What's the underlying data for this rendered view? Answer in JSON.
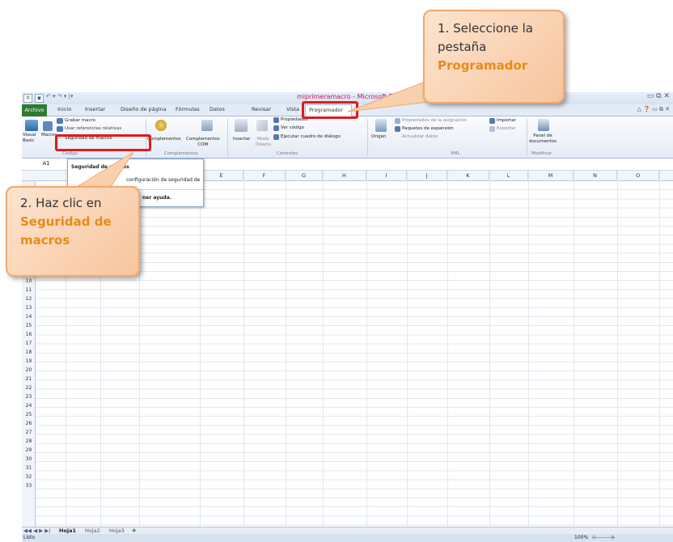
{
  "window": {
    "title": "miprimeramacro - Microsoft Excel",
    "controls": "▭ ⧉ ✕",
    "help_controls": "△ ❓ ▭ ⧉ ✕"
  },
  "tabs": [
    "Archivo",
    "Inicio",
    "Insertar",
    "Diseño de página",
    "Fórmulas",
    "Datos",
    "Revisar",
    "Vista",
    "Programador"
  ],
  "ribbon": {
    "codigo": {
      "visual_basic": "Visual\nBasic",
      "macros": "Macros",
      "grabar": "Grabar macro",
      "referencias": "Usar referencias relativas",
      "seguridad": "Seguridad de macros",
      "group": "Código"
    },
    "complementos": {
      "complementos": "Complementos",
      "com": "Complementos\nCOM",
      "group": "Complementos"
    },
    "controles": {
      "insertar": "Insertar",
      "modo": "Modo\nDiseño",
      "propiedades": "Propiedades",
      "ver_codigo": "Ver código",
      "ejecutar": "Ejecutar cuadro de diálogo",
      "group": "Controles"
    },
    "xml": {
      "origen": "Origen",
      "propiedades": "Propiedades de la asignación",
      "paquetes": "Paquetes de expansión",
      "actualizar": "Actualizar datos",
      "importar": "Importar",
      "exportar": "Exportar",
      "group": "XML"
    },
    "modificar": {
      "panel": "Panel de\ndocumentos",
      "group": "Modificar"
    }
  },
  "namebox": "A1",
  "columns": [
    "E",
    "F",
    "G",
    "H",
    "I",
    "J",
    "K",
    "L",
    "M",
    "N",
    "O"
  ],
  "rows": [
    "10",
    "11",
    "12",
    "13",
    "14",
    "15",
    "16",
    "17",
    "18",
    "19",
    "20",
    "21",
    "22",
    "23",
    "24",
    "25",
    "26",
    "27",
    "28",
    "29",
    "30",
    "31",
    "32",
    "33"
  ],
  "dropdown": {
    "title": "Seguridad de macros",
    "desc": "configuración de seguridad de",
    "help": "ner ayuda."
  },
  "sheets": [
    "Hoja1",
    "Hoja2",
    "Hoja3"
  ],
  "status": {
    "ready": "Listo",
    "zoom": "100%"
  },
  "callouts": {
    "one": {
      "line1": "1. Seleccione la",
      "line2": "pestaña",
      "highlight": "Programador"
    },
    "two": {
      "line1": "2. Haz clic en",
      "highlight1": "Seguridad de",
      "highlight2": "macros"
    }
  },
  "colors": {
    "accent": "#e88a1a",
    "highlight_box": "#e21a1a",
    "archivo_tab": "#2f7a33"
  }
}
